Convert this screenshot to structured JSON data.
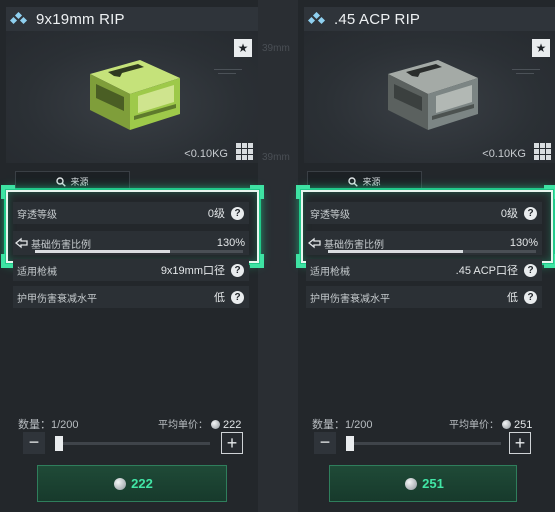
{
  "background": {
    "ghost_caliber_top": "39mm",
    "ghost_caliber_mid": "39mm"
  },
  "colors": {
    "accent": "#21c98a",
    "price_green": "#41e6a6",
    "panel": "#23272b",
    "box_lime": "#9ec94a",
    "box_grey": "#7c8584"
  },
  "panels": [
    {
      "diamond_icon": "diamonds-icon",
      "title": "9x19mm RIP",
      "star": "★",
      "weight": "<0.10KG",
      "source_label": "来源",
      "stats": [
        {
          "label": "穿透等级",
          "value": "0级"
        },
        {
          "label": "基础伤害比例",
          "value": "130%",
          "fill": 0.65
        },
        {
          "label": "适用枪械",
          "value": "9x19mm口径"
        },
        {
          "label": "护甲伤害衰减水平",
          "value": "低"
        }
      ],
      "help": "?",
      "quantity_label": "数量：1/200",
      "avg_price_label": "平均单价：",
      "avg_price": "222",
      "slider_position": 0.0,
      "minus": "−",
      "plus": "+",
      "buy_price": "222",
      "box_color": "#9ec94a"
    },
    {
      "diamond_icon": "diamonds-icon",
      "title": ".45 ACP RIP",
      "star": "★",
      "weight": "<0.10KG",
      "source_label": "来源",
      "stats": [
        {
          "label": "穿透等级",
          "value": "0级"
        },
        {
          "label": "基础伤害比例",
          "value": "130%",
          "fill": 0.65
        },
        {
          "label": "适用枪械",
          "value": ".45 ACP口径"
        },
        {
          "label": "护甲伤害衰减水平",
          "value": "低"
        }
      ],
      "help": "?",
      "quantity_label": "数量：1/200",
      "avg_price_label": "平均单价：",
      "avg_price": "251",
      "slider_position": 0.0,
      "minus": "−",
      "plus": "+",
      "buy_price": "251",
      "box_color": "#7c8584"
    }
  ]
}
